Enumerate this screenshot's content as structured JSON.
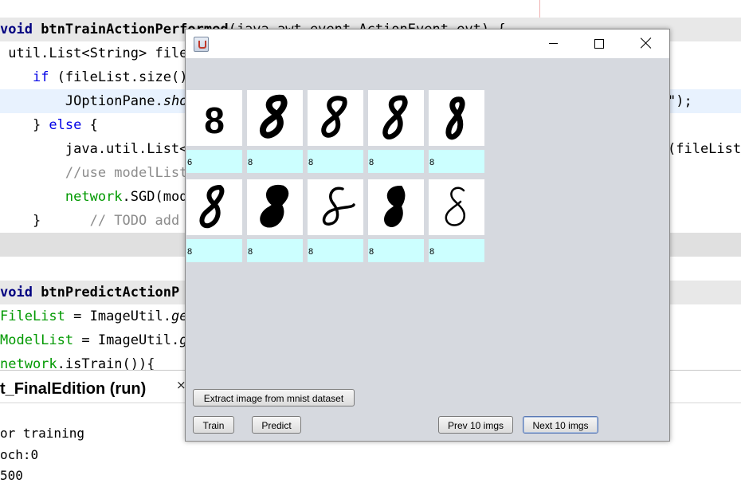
{
  "ide": {
    "code_lines": [
      {
        "segments": [
          {
            "t": "void ",
            "c": "kw"
          },
          {
            "t": "btnTrainActionPerformed",
            "c": "fn"
          },
          {
            "t": "(java.awt.event.ActionEvent evt) {",
            "c": ""
          }
        ]
      },
      {
        "segments": [
          {
            "t": " util.List<String> fileL",
            "c": ""
          }
        ]
      },
      {
        "segments": [
          {
            "t": "    ",
            "c": ""
          },
          {
            "t": "if",
            "c": "kw2"
          },
          {
            "t": " (fileList.size()",
            "c": ""
          }
        ]
      },
      {
        "segments": [
          {
            "t": "        JOptionPane.",
            "c": ""
          },
          {
            "t": "show",
            "c": "it"
          }
        ],
        "tail": "\");"
      },
      {
        "segments": [
          {
            "t": "    } ",
            "c": ""
          },
          {
            "t": "else",
            "c": "kw2"
          },
          {
            "t": " {",
            "c": ""
          }
        ]
      },
      {
        "segments": [
          {
            "t": "        java.util.List<I",
            "c": ""
          }
        ],
        "tail": "(fileList)"
      },
      {
        "segments": [
          {
            "t": "        //use modelList",
            "c": "cm"
          }
        ]
      },
      {
        "segments": [
          {
            "t": "        ",
            "c": ""
          },
          {
            "t": "network",
            "c": "gr"
          },
          {
            "t": ".SGD(mode",
            "c": ""
          }
        ]
      },
      {
        "segments": [
          {
            "t": "    }      ",
            "c": ""
          },
          {
            "t": "// TODO add",
            "c": "cm"
          }
        ]
      },
      {
        "segments": []
      },
      {
        "segments": []
      },
      {
        "segments": [
          {
            "t": "void ",
            "c": "kw"
          },
          {
            "t": "btnPredictActionP",
            "c": "fn"
          }
        ]
      },
      {
        "segments": [
          {
            "t": "FileList",
            "c": "gr"
          },
          {
            "t": " = ImageUtil.",
            "c": ""
          },
          {
            "t": "get",
            "c": "it"
          }
        ]
      },
      {
        "segments": [
          {
            "t": "ModelList",
            "c": "gr"
          },
          {
            "t": " = ImageUtil.",
            "c": ""
          },
          {
            "t": "ge",
            "c": "it"
          }
        ]
      },
      {
        "segments": [
          {
            "t": "network",
            "c": "gr"
          },
          {
            "t": ".isTrain()){",
            "c": ""
          }
        ]
      }
    ],
    "output_tab": "t_FinalEdition (run)",
    "output_close": "×",
    "output_lines": [
      "or training",
      "och:0",
      "500"
    ]
  },
  "window": {
    "title": "",
    "app_icon": "java-cup-icon",
    "controls": [
      "minimize-icon",
      "maximize-icon",
      "close-icon"
    ]
  },
  "digits": {
    "row1_predictions": [
      "6",
      "8",
      "8",
      "8",
      "8"
    ],
    "row2_predictions": [
      "8",
      "8",
      "8",
      "8",
      "8"
    ]
  },
  "buttons": {
    "extract": "Extract image from mnist dataset",
    "train": "Train",
    "predict": "Predict",
    "prev": "Prev 10 imgs",
    "next": "Next 10 imgs"
  }
}
